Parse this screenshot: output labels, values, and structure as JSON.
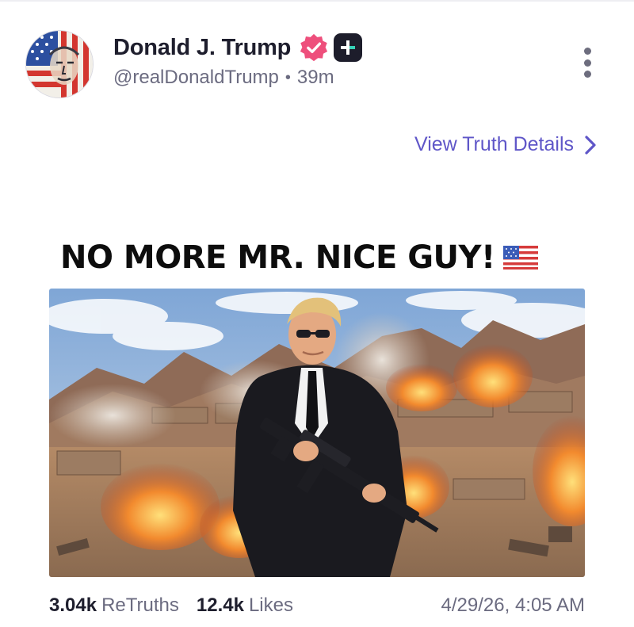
{
  "post": {
    "author_name": "Donald J. Trump",
    "handle": "@realDonaldTrump",
    "separator": "•",
    "time_ago": "39m",
    "view_details_label": "View Truth Details",
    "image_caption": "NO MORE MR. NICE GUY!",
    "retruths_count": "3.04k",
    "retruths_label": "ReTruths",
    "likes_count": "12.4k",
    "likes_label": "Likes",
    "timestamp": "4/29/26, 4:05 AM"
  },
  "icons": {
    "verified": "verified-badge-icon",
    "plus": "plus-badge-icon",
    "more": "more-vertical-icon",
    "chevron": "chevron-right-icon",
    "flag": "us-flag-icon"
  },
  "colors": {
    "accent": "#5f56c8",
    "verified": "#ee4f7c",
    "text_primary": "#1e1e2d",
    "text_secondary": "#6b6b80",
    "badge_dark": "#1d1d2b"
  }
}
